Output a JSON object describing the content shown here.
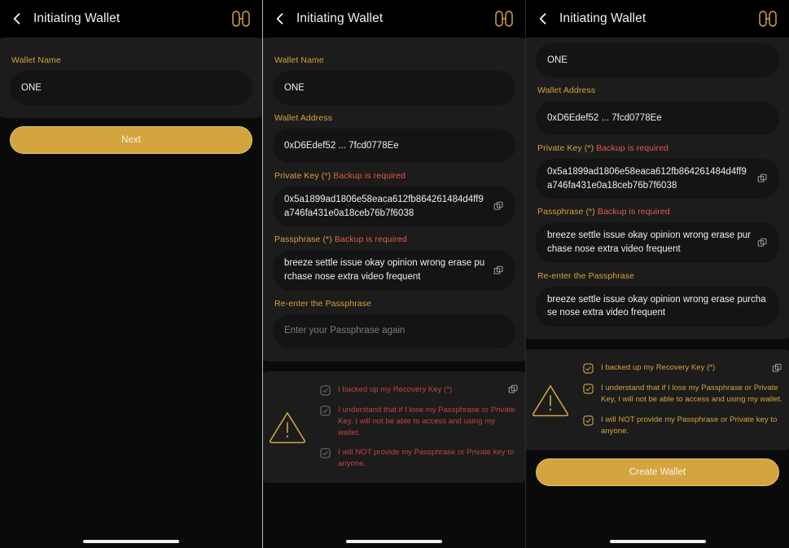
{
  "app": {
    "title": "Initiating Wallet",
    "back_icon": "back-chevron-icon",
    "logo_icon": "wallet-logo-icon",
    "copy_icon": "copy-icon",
    "warning_icon": "warning-triangle-icon",
    "check_icon": "check-icon"
  },
  "colors": {
    "accent_gold": "#d4a53f",
    "label_gold": "#d5a23c",
    "error_red": "#e05a4e",
    "pending_red": "#c0443c",
    "background": "#0a0a0a",
    "card": "#1c1c1c",
    "input": "#141414",
    "text": "#efefef"
  },
  "labels": {
    "wallet_name": "Wallet Name",
    "wallet_address": "Wallet Address",
    "private_key": "Private Key (*)",
    "private_key_req": "Backup is required",
    "passphrase": "Passphrase (*)",
    "passphrase_req": "Backup is required",
    "reenter_passphrase": "Re-enter the Passphrase"
  },
  "values": {
    "wallet_name": "ONE",
    "wallet_address": "0xD6Edef52 ... 7fcd0778Ee",
    "private_key": "0x5a1899ad1806e58eaca612fb864261484d4ff9a746fa431e0a18ceb76b7f6038",
    "passphrase": "breeze settle issue okay opinion wrong erase purchase nose extra video frequent",
    "reenter_passphrase_placeholder": "Enter your Passphrase again",
    "reenter_passphrase_filled": "breeze settle issue okay opinion wrong erase purchase nose extra video frequent"
  },
  "agreements": [
    {
      "text": "I backed up my Recovery Key (*)",
      "has_copy": true
    },
    {
      "text": "I understand that if I lose my Passphrase or Private Key, I will not be able to access and using my wallet.",
      "has_copy": false
    },
    {
      "text": "I will NOT provide my Passphrase or Private key to anyone.",
      "has_copy": false
    }
  ],
  "buttons": {
    "next": "Next",
    "create_wallet": "Create Wallet"
  },
  "screens": [
    {
      "id": "screen-1-wallet-name"
    },
    {
      "id": "screen-2-key-details"
    },
    {
      "id": "screen-3-confirm"
    }
  ]
}
